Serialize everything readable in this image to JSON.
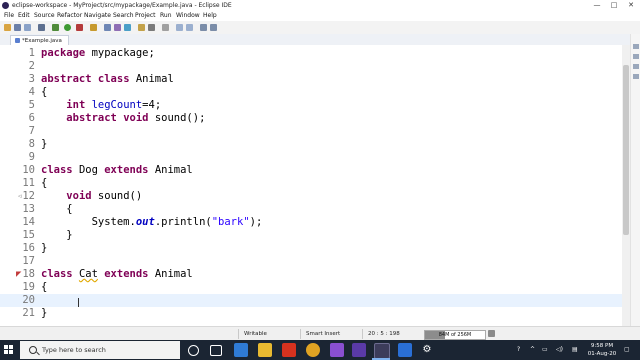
{
  "window": {
    "title": "eclipse-workspace - MyProject/src/mypackage/Example.java - Eclipse IDE",
    "controls": [
      "—",
      "□",
      "✕"
    ]
  },
  "menu": [
    "File",
    "Edit",
    "Source",
    "Refactor",
    "Navigate",
    "Search",
    "Project",
    "Run",
    "Window",
    "Help"
  ],
  "editor_tab": {
    "label": "*Example.java",
    "close": "✕"
  },
  "code": {
    "line_numbers": [
      "1",
      "2",
      "3",
      "4",
      "5",
      "6",
      "7",
      "8",
      "9",
      "10",
      "11",
      "12",
      "13",
      "14",
      "15",
      "16",
      "17",
      "18",
      "19",
      "20",
      "21"
    ],
    "line1": {
      "kw": "package",
      "rest": " mypackage;"
    },
    "line3": {
      "kw1": "abstract",
      "kw2": "class",
      "name": "Animal"
    },
    "brace_open": "{",
    "brace_close": "}",
    "line5": {
      "kw": "int",
      "field": "legCount",
      "rest": "=4;"
    },
    "line6": {
      "kw1": "abstract",
      "kw2": "void",
      "rest": "sound();"
    },
    "line10": {
      "kw1": "class",
      "name": "Dog",
      "kw2": "extends",
      "super": "Animal"
    },
    "line12": {
      "kw": "void",
      "rest": "sound()"
    },
    "line14": {
      "pre": "System.",
      "field": "out",
      "mid": ".println(",
      "str": "\"bark\"",
      "post": ");"
    },
    "line18": {
      "kw1": "class",
      "name": "Cat",
      "kw2": "extends",
      "super": "Animal"
    }
  },
  "status": {
    "mode": "Writable",
    "insert": "Smart Insert",
    "position": "20 : 5 : 198",
    "heap": "84M of 256M",
    "heap_used_fraction": 0.33
  },
  "taskbar": {
    "search_placeholder": "Type here to search",
    "time": "9:58 PM",
    "date": "01-Aug-20"
  }
}
